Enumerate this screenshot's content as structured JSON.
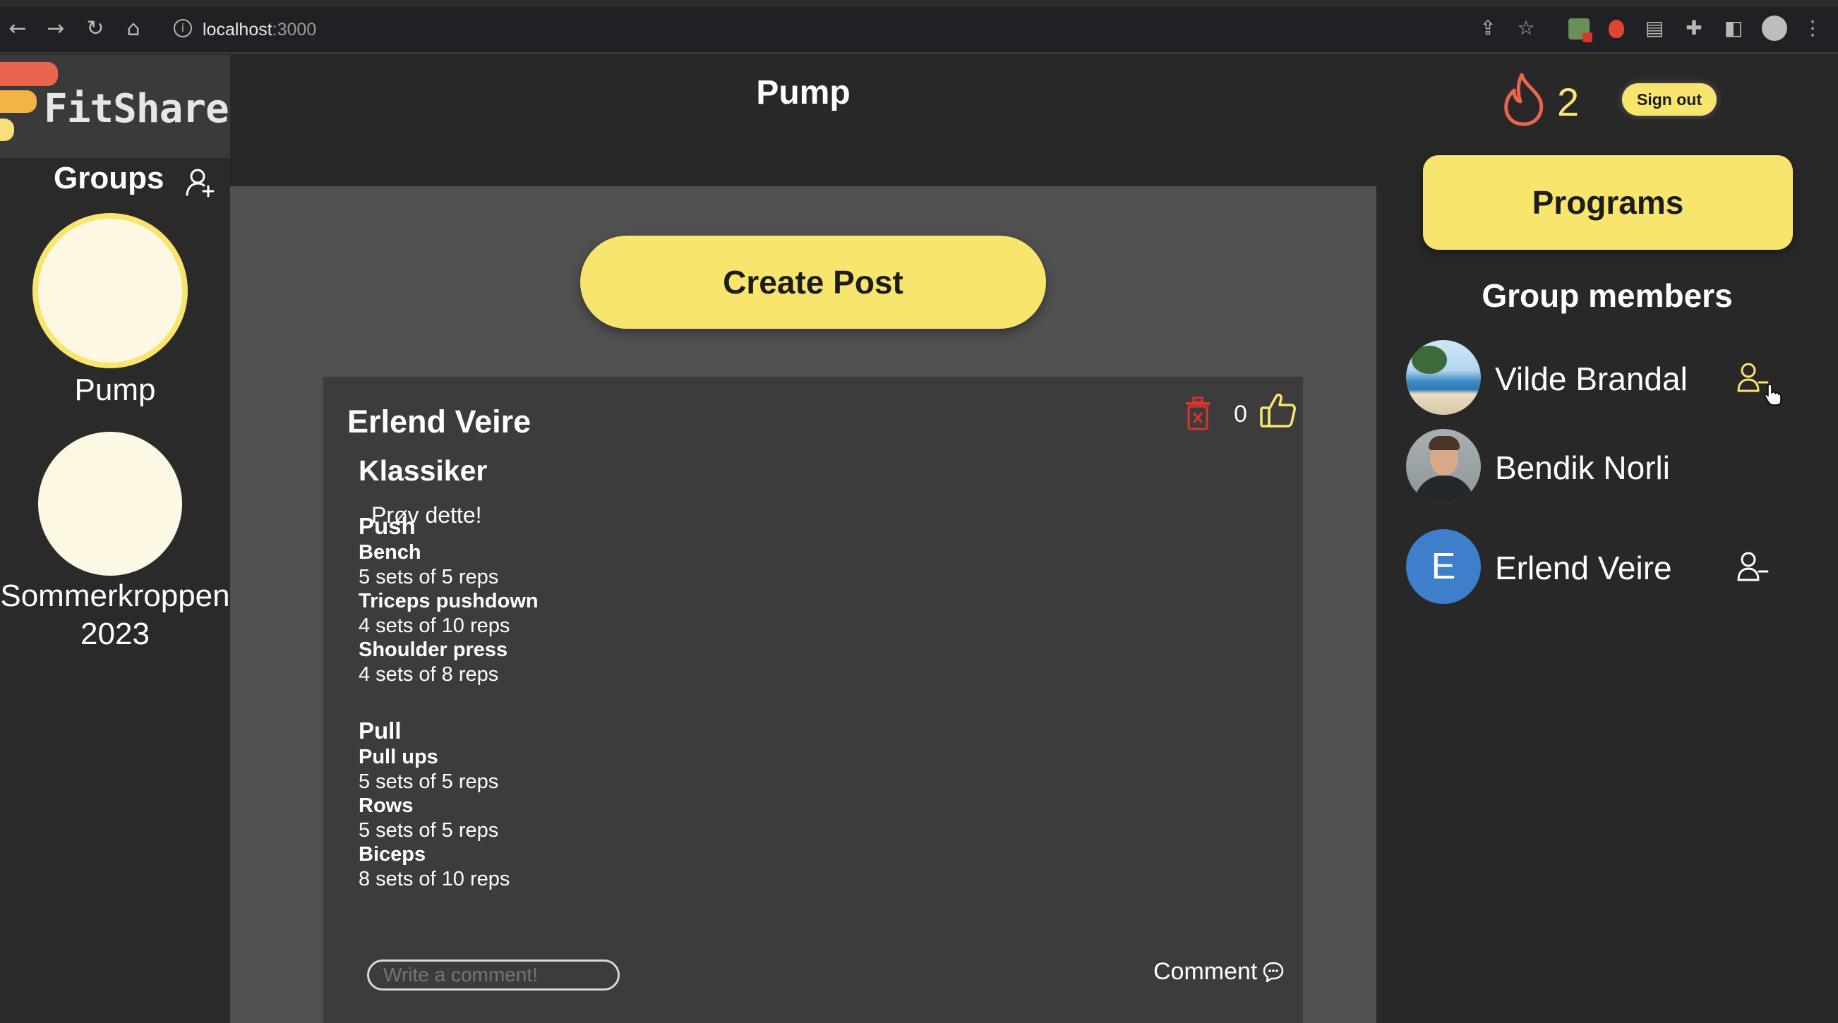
{
  "browser": {
    "url_host": "localhost",
    "url_port": ":3000"
  },
  "app": {
    "logo_text": "FitShare"
  },
  "sidebar": {
    "groups_heading": "Groups",
    "groups": [
      {
        "label": "Pump",
        "selected": true
      },
      {
        "label": "Sommerkroppen 2023",
        "selected": false
      }
    ]
  },
  "header": {
    "title": "Pump"
  },
  "feed": {
    "create_post_label": "Create Post",
    "post": {
      "author": "Erlend Veire",
      "title": "Klassiker",
      "description": "Prøv dette!",
      "likes": "0",
      "days": [
        {
          "name": "Push",
          "exercises": [
            {
              "name": "Bench",
              "sets": "5 sets of 5 reps"
            },
            {
              "name": "Triceps pushdown",
              "sets": "4 sets of 10 reps"
            },
            {
              "name": "Shoulder press",
              "sets": "4 sets of 8 reps"
            }
          ]
        },
        {
          "name": "Pull",
          "exercises": [
            {
              "name": "Pull ups",
              "sets": "5 sets of 5 reps"
            },
            {
              "name": "Rows",
              "sets": "5 sets of 5 reps"
            },
            {
              "name": "Biceps",
              "sets": "8 sets of 10 reps"
            }
          ]
        }
      ],
      "comment_placeholder": "Write a comment!",
      "comment_button": "Comment"
    }
  },
  "right_panel": {
    "streak_count": "2",
    "sign_out_label": "Sign out",
    "programs_label": "Programs",
    "members_heading": "Group members",
    "members": [
      {
        "name": "Vilde Brandal",
        "avatar": "photo-beach",
        "action": "remove-member-icon"
      },
      {
        "name": "Bendik Norli",
        "avatar": "photo-man",
        "action": ""
      },
      {
        "name": "Erlend Veire",
        "avatar": "letter",
        "avatar_letter": "E",
        "action": "remove-member-icon"
      }
    ]
  },
  "colors": {
    "accent_yellow": "#f8e56d",
    "streak_orange": "#e9654f",
    "delete_red": "#d8362c",
    "avatar_blue": "#3e7fcb"
  },
  "icons": {
    "back": "back-arrow-icon",
    "forward": "forward-arrow-icon",
    "reload": "reload-icon",
    "home": "home-icon",
    "site_info": "info-icon",
    "share": "share-icon",
    "bookmark": "star-icon",
    "extensions": "puzzle-icon",
    "sidepanel": "side-panel-icon",
    "menu": "kebab-menu-icon",
    "add_group": "add-group-icon",
    "streak": "flame-icon",
    "delete_post": "trash-icon",
    "like": "thumbs-up-icon",
    "comment": "chat-bubble-icon"
  }
}
